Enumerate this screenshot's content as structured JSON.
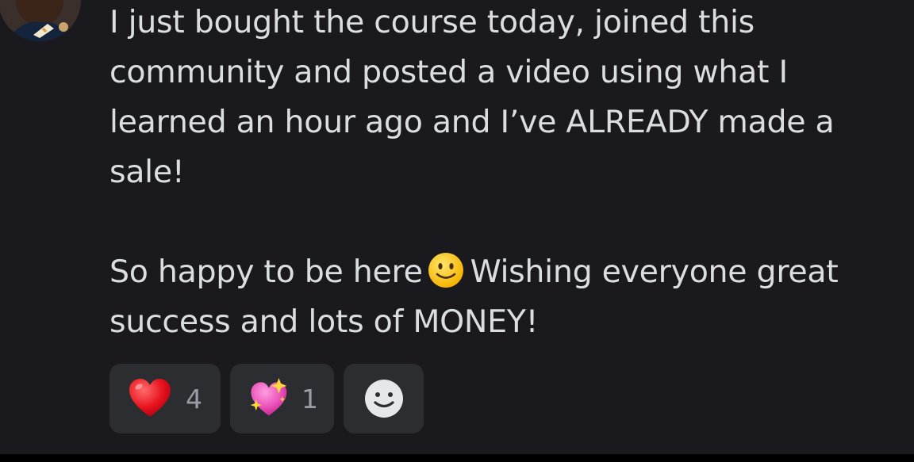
{
  "message": {
    "lines": [
      "I just bought the course today, joined this",
      "community and posted a video using what I",
      "learned an hour ago and I’ve ALREADY made a",
      "sale!"
    ],
    "line5_before": "So happy to be here",
    "line5_after": "Wishing everyone great",
    "line6": "success and lots of MONEY!",
    "inline_emoji": "slightly-smiling-face-icon"
  },
  "reactions": [
    {
      "emoji": "red-heart-icon",
      "count": "4"
    },
    {
      "emoji": "sparkling-heart-icon",
      "count": "1"
    }
  ],
  "add_reaction_icon": "add-reaction-icon",
  "colors": {
    "background": "#1a1a1e",
    "text": "#dbdee1",
    "reaction_bg": "#2b2d31",
    "count_text": "#9a9ca3"
  }
}
